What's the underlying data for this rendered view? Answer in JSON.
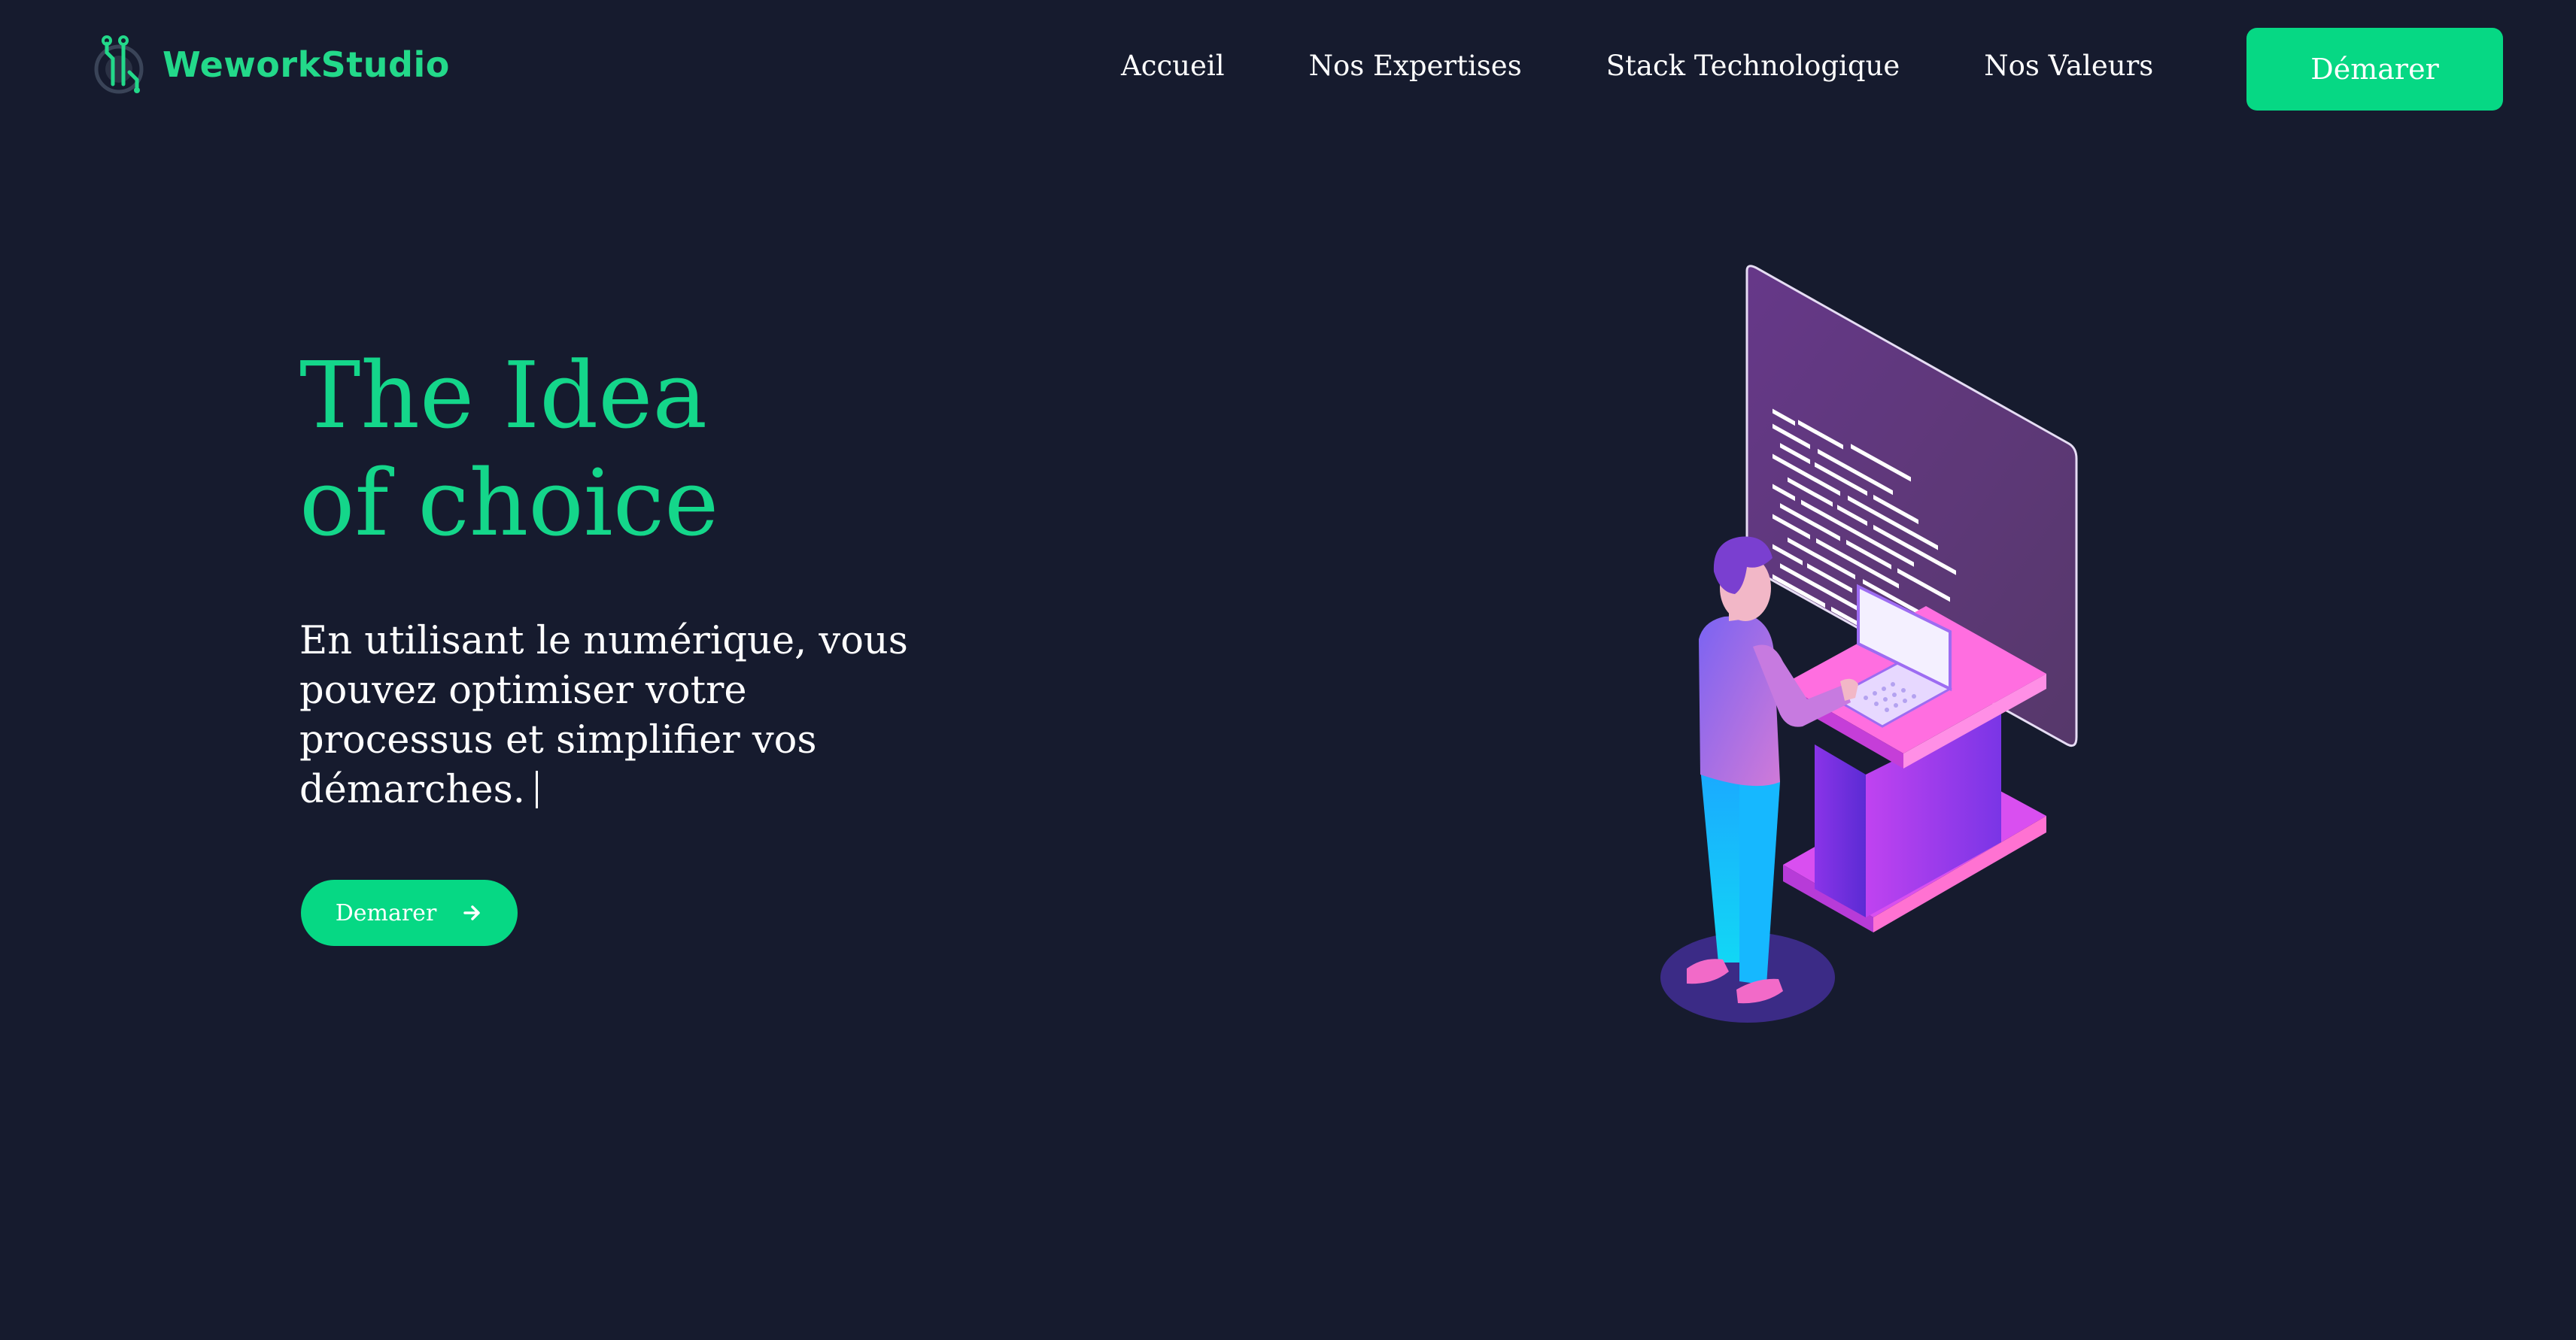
{
  "brand": {
    "name": "WeworkStudio",
    "accent": "#06d884",
    "background": "#161b2e"
  },
  "nav": {
    "items": [
      "Accueil",
      "Nos Expertises",
      "Stack Technologique",
      "Nos Valeurs"
    ],
    "cta_label": "Démarer"
  },
  "hero": {
    "title_line1": "The Idea",
    "title_line2": "of choice",
    "text": "En utilisant le numérique, vous pouvez optimiser votre processus et simplifier vos démarches.",
    "cta_label": "Demarer",
    "cta_icon": "arrow-right-icon"
  },
  "illustration": {
    "subject": "isometric developer at laptop with code screen",
    "icon": "developer-illustration"
  }
}
